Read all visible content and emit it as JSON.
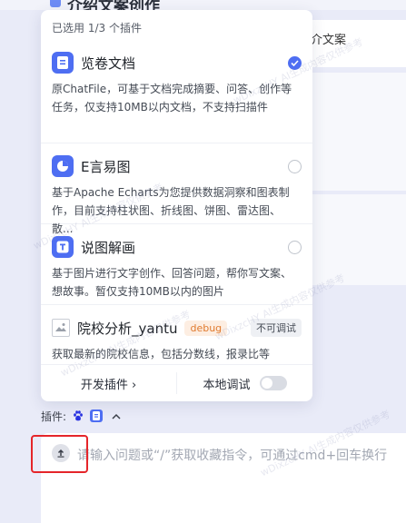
{
  "background": {
    "title": "介绍文案创作",
    "right_snippet": "介文案"
  },
  "popover": {
    "header": "已选用 1/3 个插件",
    "plugins": [
      {
        "name": "览卷文档",
        "icon": "document-icon",
        "description": "原ChatFile，可基于文档完成摘要、问答、创作等任务，仅支持10MB以内文档，不支持扫描件",
        "selected": true
      },
      {
        "name": "E言易图",
        "icon": "pie-chart-icon",
        "description": "基于Apache Echarts为您提供数据洞察和图表制作，目前支持柱状图、折线图、饼图、雷达图、散...",
        "selected": false
      },
      {
        "name": "说图解画",
        "icon": "image-text-icon",
        "description": "基于图片进行文字创作、回答问题，帮你写文案、想故事。暂仅支持10MB以内的图片",
        "selected": false
      },
      {
        "name": "院校分析_yantu",
        "icon": "broken-image-icon",
        "badge": "debug",
        "status": "不可调试",
        "description": "获取最新的院校信息，包括分数线，报录比等"
      }
    ],
    "footer": {
      "develop_label": "开发插件 ›",
      "local_debug_label": "本地调试",
      "local_debug_on": false
    }
  },
  "plugin_bar": {
    "label": "插件:"
  },
  "input": {
    "placeholder": "请输入问题或“/”获取收藏指令，可通过cmd+回车换行"
  },
  "watermark": "wDixzcHY AI生成内容仅供参考",
  "colors": {
    "accent": "#4e6ef2",
    "highlight": "#e5252a",
    "debug_badge": "#e07a2e"
  }
}
